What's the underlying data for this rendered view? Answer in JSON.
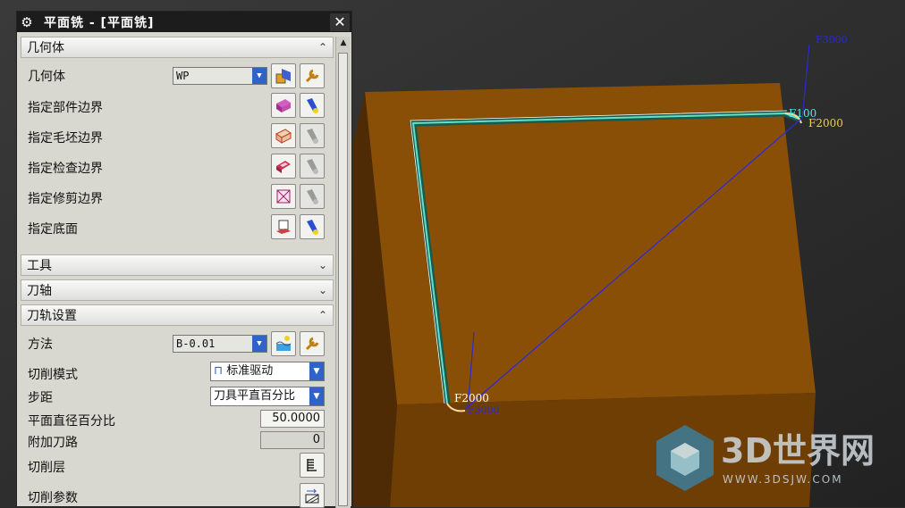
{
  "dialog": {
    "title": "平面铣 - [平面铣]",
    "sections": {
      "geometry": "几何体",
      "tool": "工具",
      "axis": "刀轴",
      "path": "刀轨设置"
    },
    "geometry_rows": {
      "geometry_label": "几何体",
      "geometry_value": "WP",
      "part_boundary": "指定部件边界",
      "blank_boundary": "指定毛坯边界",
      "check_boundary": "指定检查边界",
      "trim_boundary": "指定修剪边界",
      "floor": "指定底面"
    },
    "path_rows": {
      "method_label": "方法",
      "method_value": "B-0.01",
      "cut_mode_label": "切削模式",
      "cut_mode_value": "标准驱动",
      "stepover_label": "步距",
      "stepover_value": "刀具平直百分比",
      "diameter_pct_label": "平面直径百分比",
      "diameter_pct_value": "50.0000",
      "additional_passes_label": "附加刀路",
      "additional_passes_value": "0",
      "cut_levels_label": "切削层",
      "cut_params_label": "切削参数"
    }
  },
  "viewport": {
    "feed_labels": {
      "top": "F3000",
      "f100": "F100",
      "f2000_right": "F2000",
      "f2000_left": "F2000",
      "bottom": "F3000"
    },
    "colors": {
      "block_top": "#8a4f06",
      "block_front": "#6e3e05",
      "block_left": "#4f2b05",
      "toolpath": "#62e0c8",
      "rapid": "#2a2ad8"
    }
  },
  "watermark": {
    "brand": "3D世界网",
    "url": "WWW.3DSJW.COM"
  }
}
